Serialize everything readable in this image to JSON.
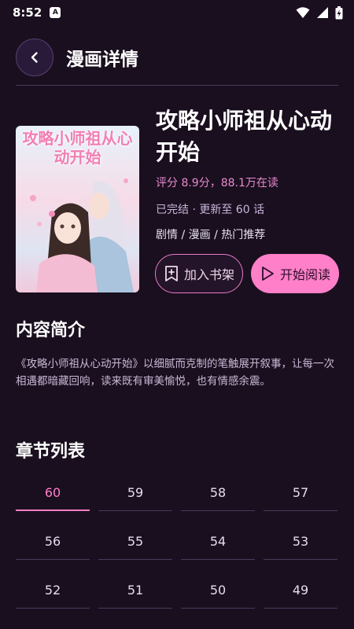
{
  "status_bar": {
    "time": "8:52",
    "app_badge": "A"
  },
  "header": {
    "title": "漫画详情"
  },
  "comic": {
    "cover_title": "攻略小师祖从心动开始",
    "title": "攻略小师祖从心动开始",
    "rating": "评分 8.9分，88.1万在读",
    "update": "已完结 · 更新至 60 话",
    "tags": "剧情 / 漫画 / 热门推荐"
  },
  "actions": {
    "bookshelf_label": "加入书架",
    "read_label": "开始阅读"
  },
  "intro": {
    "heading": "内容简介",
    "text": "《攻略小师祖从心动开始》以细腻而克制的笔触展开叙事，让每一次相遇都暗藏回响，读来既有审美愉悦，也有情感余震。"
  },
  "chapters": {
    "heading": "章节列表",
    "items": [
      "60",
      "59",
      "58",
      "57",
      "56",
      "55",
      "54",
      "53",
      "52",
      "51",
      "50",
      "49"
    ],
    "active": "60"
  },
  "colors": {
    "background": "#1a0f1f",
    "accent": "#ff7fc8",
    "rating": "#e88ad0"
  }
}
